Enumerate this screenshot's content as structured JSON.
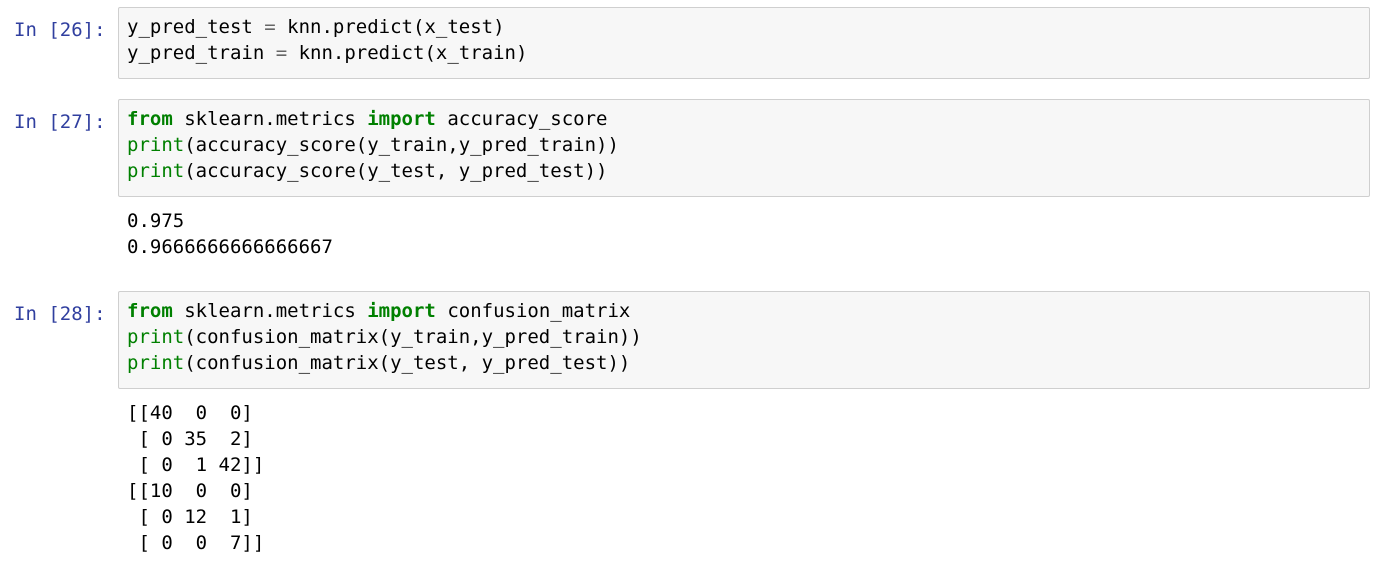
{
  "cells": [
    {
      "prompt": "In [26]:",
      "lines": [
        [
          "y_pred_test ",
          "= ",
          "knn.predict(x_test)"
        ],
        [
          "y_pred_train ",
          "= ",
          "knn.predict(x_train)"
        ]
      ],
      "outputs": []
    },
    {
      "prompt": "In [27]:",
      "lines": [
        [
          "from",
          " sklearn.metrics ",
          "import",
          " accuracy_score"
        ],
        [
          "print",
          "(accuracy_score(y_train,y_pred_train))"
        ],
        [
          "print",
          "(accuracy_score(y_test, y_pred_test))"
        ]
      ],
      "outputs": [
        "0.975",
        "0.9666666666666667"
      ]
    },
    {
      "prompt": "In [28]:",
      "lines": [
        [
          "from",
          " sklearn.metrics ",
          "import",
          " confusion_matrix"
        ],
        [
          "print",
          "(confusion_matrix(y_train,y_pred_train))"
        ],
        [
          "print",
          "(confusion_matrix(y_test, y_pred_test))"
        ]
      ],
      "outputs": [
        "[[40  0  0]",
        " [ 0 35  2]",
        " [ 0  1 42]]",
        "[[10  0  0]",
        " [ 0 12  1]",
        " [ 0  0  7]]"
      ]
    }
  ],
  "colors": {
    "prompt": "#303f9f",
    "keyword": "#008000",
    "operator": "#666666",
    "input_bg": "#f7f7f7",
    "input_border": "#cfcfcf"
  }
}
